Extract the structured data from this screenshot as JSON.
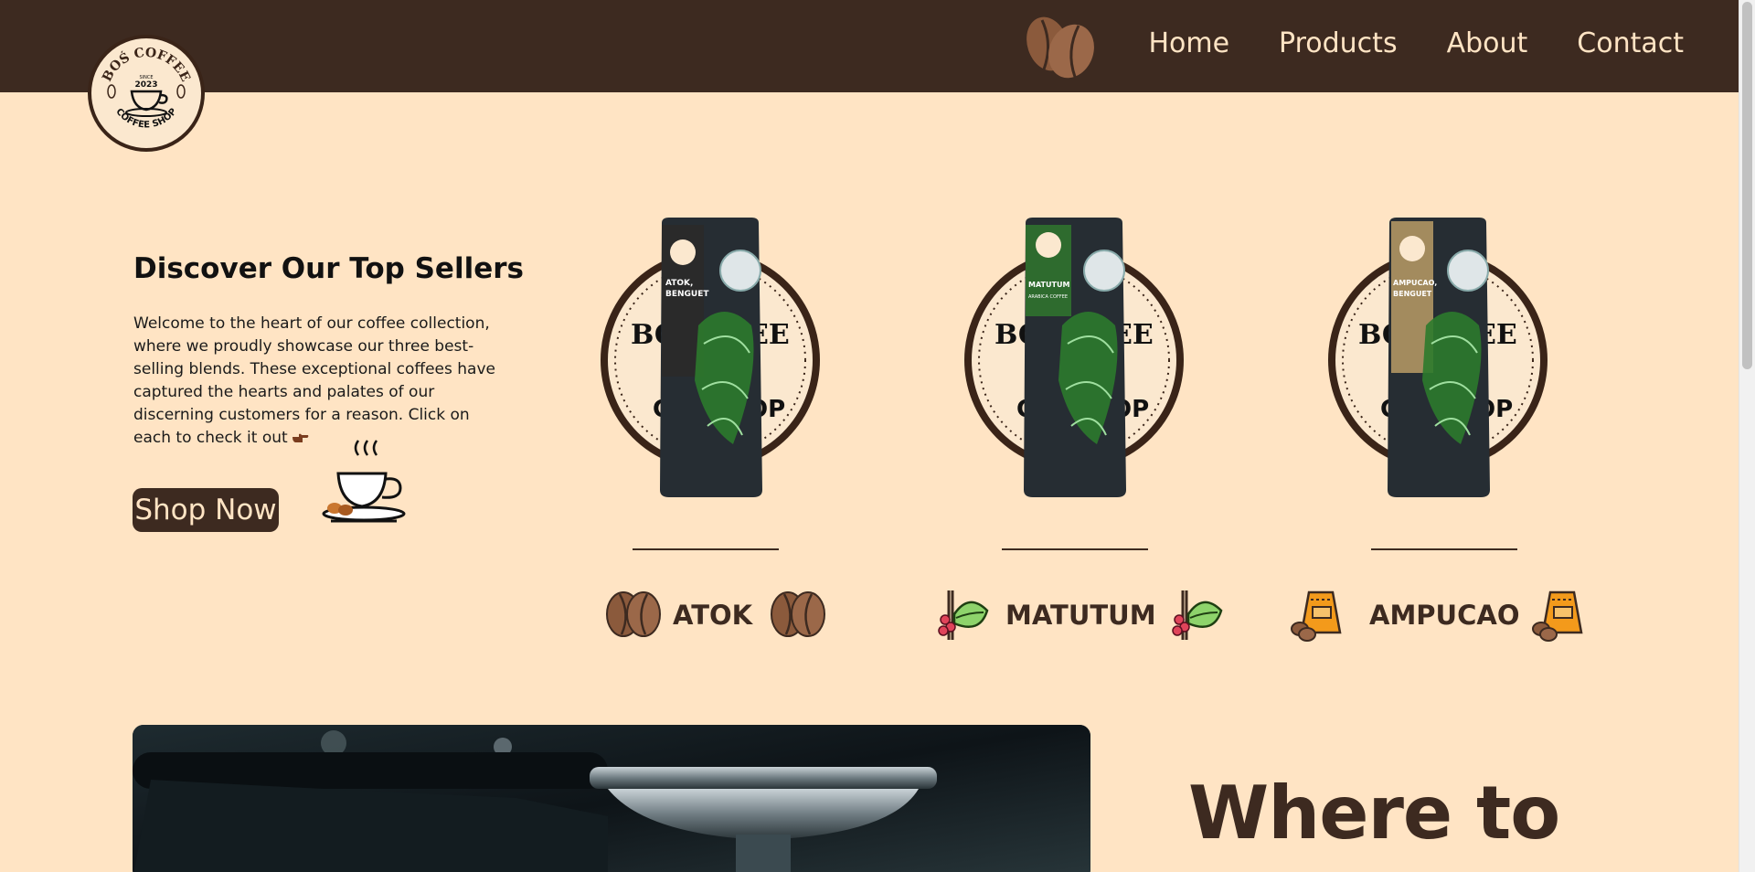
{
  "nav": {
    "logo": {
      "arc_text": "BOŚ COFFEE",
      "since": "SINCE",
      "year": "2023",
      "bottom_text": "COFFEE SHOP"
    },
    "links": [
      "Home",
      "Products",
      "About",
      "Contact"
    ]
  },
  "hero": {
    "title": "Discover Our Top Sellers",
    "description": "Welcome to the heart of our coffee collection, where we proudly showcase our three best-selling blends. These exceptional coffees have captured the hearts and palates of our discerning customers for a reason. Click on each to check it out",
    "shop_button": "Shop Now"
  },
  "products": [
    {
      "name": "ATOK",
      "label_line1": "ATOK,",
      "label_line2": "BENGUET",
      "label_color": "#2a2a2a",
      "icon": "coffee-beans-icon"
    },
    {
      "name": "MATUTUM",
      "label_line1": "MATUTUM",
      "label_line2": "ARABICA COFFEE",
      "label_color": "#2e6b2e",
      "icon": "coffee-plant-icon"
    },
    {
      "name": "AMPUCAO",
      "label_line1": "AMPUCAO,",
      "label_line2": "BENGUET",
      "label_color": "#a38b5e",
      "icon": "coffee-bag-icon"
    }
  ],
  "where": {
    "title": "Where to"
  },
  "colors": {
    "navbar": "#3d2a20",
    "background": "#ffe4c4",
    "accent_text": "#ffe4c4",
    "bean_brown": "#8b5a3c"
  }
}
